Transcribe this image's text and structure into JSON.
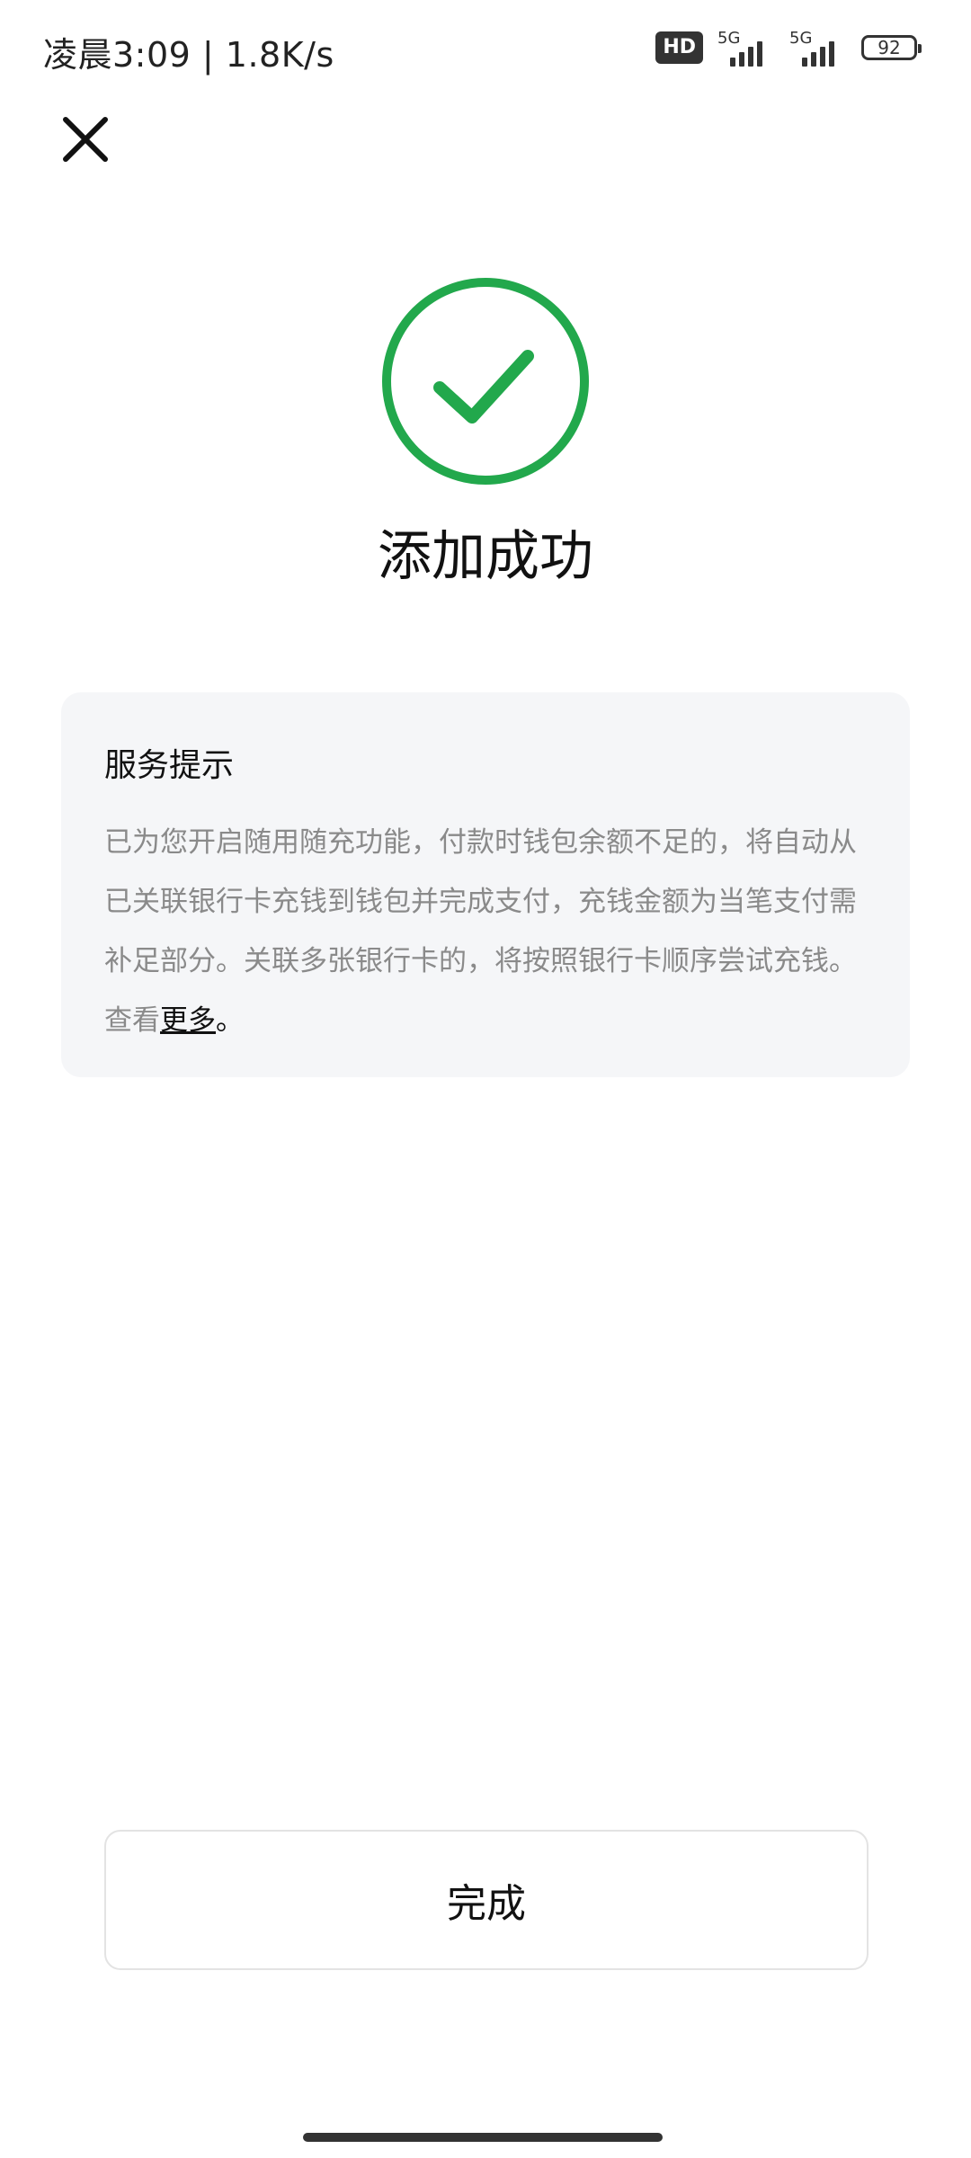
{
  "status_bar": {
    "time_speed": "凌晨3:09 | 1.8K/s",
    "hd_badge": "HD",
    "network_1": "5G",
    "network_2": "5G",
    "battery": "92"
  },
  "header": {
    "close_icon": "close-icon"
  },
  "result": {
    "icon": "check-circle-icon",
    "accent_color": "#22a84c",
    "title": "添加成功"
  },
  "notice": {
    "title": "服务提示",
    "body": "已为您开启随用随充功能，付款时钱包余额不足的，将自动从已关联银行卡充钱到钱包并完成支付，充钱金额为当笔支付需补足部分。关联多张银行卡的，将按照银行卡顺序尝试充钱。查看",
    "link": "更多",
    "tail": "。"
  },
  "actions": {
    "done_label": "完成"
  }
}
